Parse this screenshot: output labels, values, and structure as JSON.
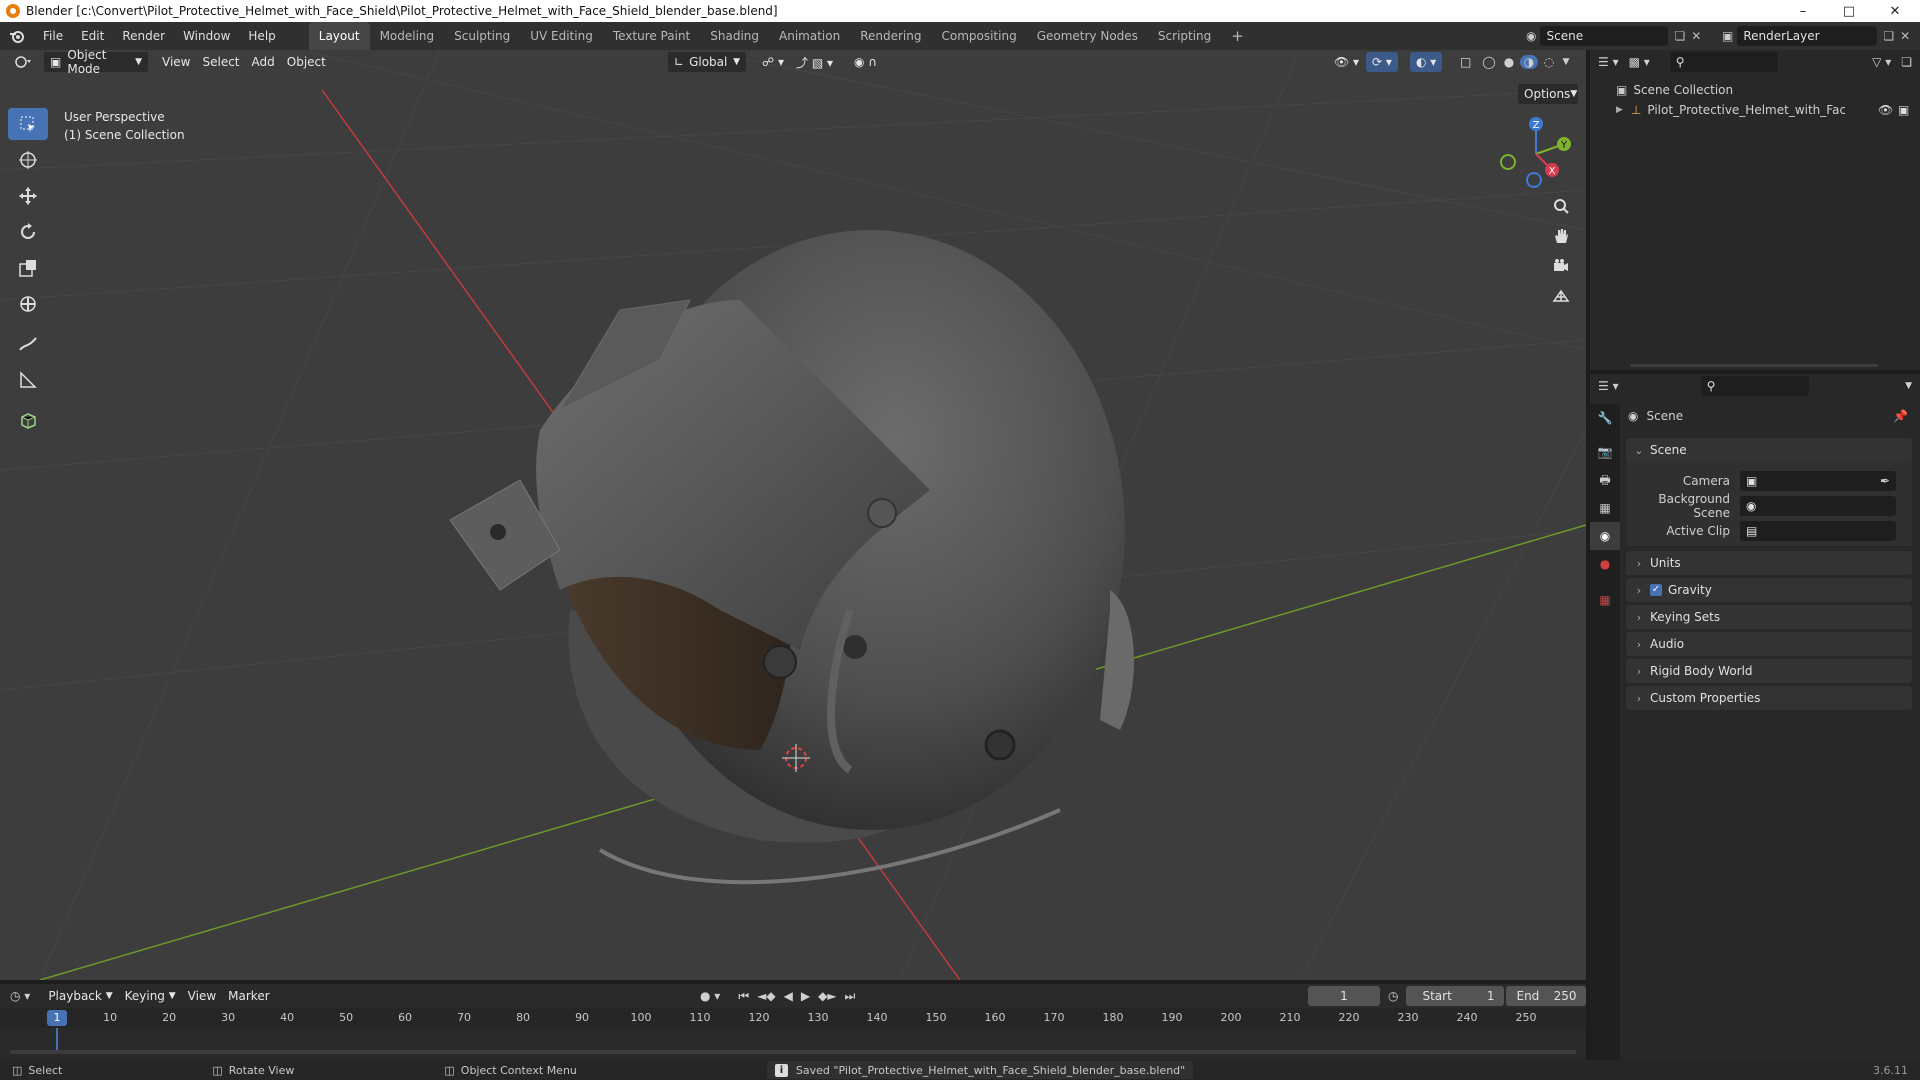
{
  "window": {
    "title": "Blender [c:\\Convert\\Pilot_Protective_Helmet_with_Face_Shield\\Pilot_Protective_Helmet_with_Face_Shield_blender_base.blend]",
    "minimize": "–",
    "maximize": "□",
    "close": "✕"
  },
  "menu": {
    "items": [
      "File",
      "Edit",
      "Render",
      "Window",
      "Help"
    ]
  },
  "workspaces": {
    "tabs": [
      "Layout",
      "Modeling",
      "Sculpting",
      "UV Editing",
      "Texture Paint",
      "Shading",
      "Animation",
      "Rendering",
      "Compositing",
      "Geometry Nodes",
      "Scripting"
    ],
    "active": "Layout",
    "add": "+"
  },
  "scene": {
    "name": "Scene",
    "render_layer": "RenderLayer"
  },
  "viewport_header": {
    "mode": "Object Mode",
    "menus": [
      "View",
      "Select",
      "Add",
      "Object"
    ],
    "transform": "Global",
    "options": "Options"
  },
  "viewport": {
    "line1": "User Perspective",
    "line2": "(1) Scene Collection",
    "colors": {
      "bg": "#3d3d3d",
      "x_axis": "#c23b3b",
      "y_axis": "#6f9a2b",
      "grid": "#454545"
    }
  },
  "gizmo": {
    "z": "Z",
    "y": "Y",
    "x": "X"
  },
  "outliner": {
    "root": "Scene Collection",
    "items": [
      {
        "name": "Pilot_Protective_Helmet_with_Face_Shi"
      }
    ]
  },
  "properties": {
    "context_title": "Scene",
    "section": "Scene",
    "camera_label": "Camera",
    "background_label": "Background Scene",
    "clip_label": "Active Clip",
    "panels": [
      "Units",
      "Gravity",
      "Keying Sets",
      "Audio",
      "Rigid Body World",
      "Custom Properties"
    ],
    "gravity_checked": true
  },
  "timeline": {
    "menus": [
      "Playback",
      "Keying",
      "View",
      "Marker"
    ],
    "current_frame": "1",
    "start_label": "Start",
    "start": "1",
    "end_label": "End",
    "end": "250",
    "ticks": [
      "1",
      "10",
      "20",
      "30",
      "40",
      "50",
      "60",
      "70",
      "80",
      "90",
      "100",
      "110",
      "120",
      "130",
      "140",
      "150",
      "160",
      "170",
      "180",
      "190",
      "200",
      "210",
      "220",
      "230",
      "240",
      "250"
    ]
  },
  "status": {
    "select": "Select",
    "rotate": "Rotate View",
    "context": "Object Context Menu",
    "message": "Saved \"Pilot_Protective_Helmet_with_Face_Shield_blender_base.blend\"",
    "version": "3.6.11"
  },
  "accent": "#4772b3"
}
